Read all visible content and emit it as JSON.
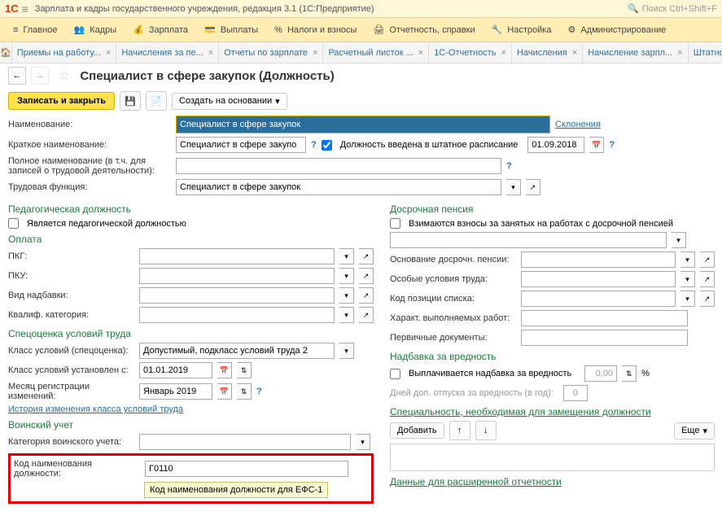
{
  "titlebar": {
    "title": "Зарплата и кадры государственного учреждения, редакция 3.1  (1С:Предприятие)",
    "search_placeholder": "Поиск Ctrl+Shift+F"
  },
  "menu": {
    "main": "Главное",
    "kadry": "Кадры",
    "zarplata": "Зарплата",
    "vyplaty": "Выплаты",
    "nalogi": "Налоги и взносы",
    "otchet": "Отчетность, справки",
    "nastroyka": "Настройка",
    "admin": "Администрирование"
  },
  "tabs": [
    "Приемы на работу...",
    "Начисления за пе...",
    "Отчеты по зарплате",
    "Расчетный листок ...",
    "1С-Отчетность",
    "Начисления",
    "Начисление зарпл...",
    "Штатное расписание"
  ],
  "page_title": "Специалист в сфере закупок (Должность)",
  "actions": {
    "save_close": "Записать и закрыть",
    "create_basis": "Создать на основании"
  },
  "form": {
    "name_lbl": "Наименование:",
    "name_val": "Специалист в сфере закупок",
    "decl_link": "Склонения",
    "short_lbl": "Краткое наименование:",
    "short_val": "Специалист в сфере закупо",
    "dolzh_vved": "Должность введена в штатное расписание",
    "dolzh_date": "01.09.2018",
    "full_lbl": "Полное наименование (в т.ч. для записей о трудовой деятельности):",
    "func_lbl": "Трудовая функция:",
    "func_val": "Специалист в сфере закупок"
  },
  "ped": {
    "title": "Педагогическая должность",
    "cb": "Является педагогической должностью"
  },
  "oplata": {
    "title": "Оплата",
    "pkg": "ПКГ:",
    "pku": "ПКУ:",
    "nadb": "Вид надбавки:",
    "kval": "Квалиф. категория:"
  },
  "spec": {
    "title": "Спецоценка условий труда",
    "class_lbl": "Класс условий (спецоценка):",
    "class_val": "Допустимый, подкласс условий труда 2",
    "date_lbl": "Класс условий установлен с:",
    "date_val": "01.01.2019",
    "month_lbl": "Месяц регистрации изменений:",
    "month_val": "Январь 2019",
    "history": "История изменения класса условий труда"
  },
  "voin": {
    "title": "Воинский учет",
    "cat_lbl": "Категория воинского учета:",
    "code_lbl": "Код наименования должности:",
    "code_val": "Г0110",
    "tooltip": "Код наименования должности для ЕФС-1"
  },
  "pension": {
    "title": "Досрочная пенсия",
    "cb": "Взимаются взносы за занятых на работах с досрочной пенсией",
    "osn": "Основание досрочн. пенсии:",
    "usl": "Особые условия труда:",
    "poz": "Код позиции списка:",
    "har": "Характ. выполняемых работ:",
    "perv": "Первичные документы:"
  },
  "nadb": {
    "title": "Надбавка за вредность",
    "cb": "Выплачивается надбавка за вредность",
    "val": "0,00",
    "pct": "%",
    "days": "Дней доп. отпуска за вредность (в год):",
    "days_val": "0"
  },
  "special": {
    "title": "Специальность, необходимая для замещения должности",
    "add": "Добавить",
    "more": "Еще"
  },
  "ext": {
    "title": "Данные для расширенной отчетности"
  }
}
